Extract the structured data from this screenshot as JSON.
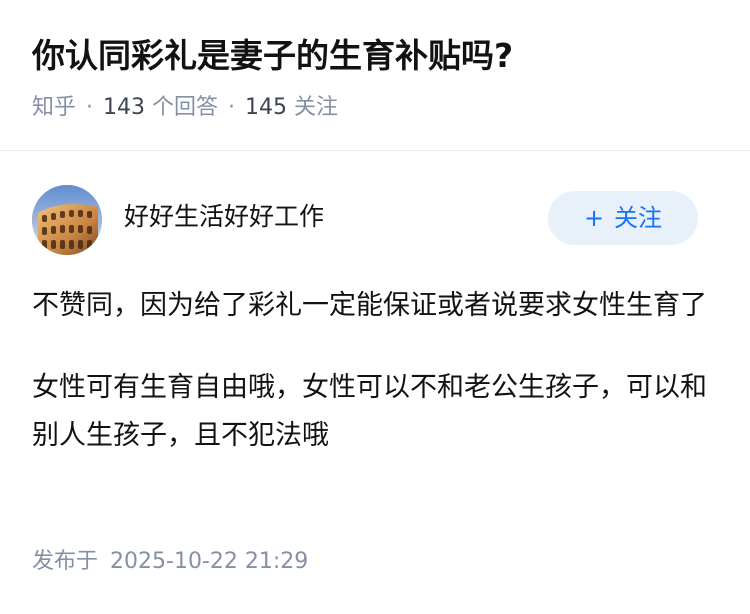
{
  "question": {
    "title": "你认同彩礼是妻子的生育补贴吗?",
    "source": "知乎",
    "separator": "·",
    "answer_count": "143",
    "answer_label": "个回答",
    "follower_count": "145",
    "follower_label": "关注"
  },
  "answer": {
    "author": {
      "name": "好好生活好好工作",
      "avatar_icon": "colosseum-avatar-icon"
    },
    "follow_button": {
      "icon": "plus-icon",
      "plus": "+",
      "label": "关注"
    },
    "paragraphs": [
      "不赞同，因为给了彩礼一定能保证或者说要求女性生育了",
      "女性可有生育自由哦，女性可以不和老公生孩子，可以和别人生孩子，且不犯法哦"
    ],
    "published_label": "发布于",
    "published_time": "2025-10-22 21:29"
  },
  "colors": {
    "accent": "#1772f6",
    "follow_bg": "#e8f0f9",
    "meta_gray": "#8590a6",
    "title": "#121212"
  }
}
